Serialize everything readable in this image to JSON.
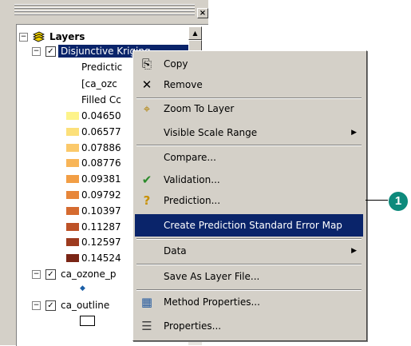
{
  "window": {
    "close_glyph": "×"
  },
  "toc": {
    "root": {
      "label": "Layers",
      "expander": "−",
      "icon": "layers-icon"
    },
    "layer1": {
      "label": "Disjunctive Kriging",
      "expander": "−",
      "checked": "✓",
      "sublabels": [
        "Predictic",
        "[ca_ozc",
        "Filled Cc"
      ],
      "classes": [
        {
          "value": "0.04650",
          "color": "#fdf38a"
        },
        {
          "value": "0.06577",
          "color": "#fce07a"
        },
        {
          "value": "0.07886",
          "color": "#fbc96a"
        },
        {
          "value": "0.08776",
          "color": "#f8b558"
        },
        {
          "value": "0.09381",
          "color": "#f29e45"
        },
        {
          "value": "0.09792",
          "color": "#e7863a"
        },
        {
          "value": "0.10397",
          "color": "#d56b30"
        },
        {
          "value": "0.11287",
          "color": "#bd5227"
        },
        {
          "value": "0.12597",
          "color": "#9d3b1f"
        },
        {
          "value": "0.14524",
          "color": "#7a2515"
        }
      ]
    },
    "layer2": {
      "label": "ca_ozone_p",
      "expander": "−",
      "checked": "✓",
      "symbol": "◆"
    },
    "layer3": {
      "label": "ca_outline",
      "expander": "−",
      "checked": "✓"
    }
  },
  "context_menu": {
    "items": [
      {
        "label": "Copy",
        "icon": "copy-icon",
        "glyph": "⎘"
      },
      {
        "label": "Remove",
        "icon": "remove-icon",
        "glyph": "✕"
      },
      {
        "label": "Zoom To Layer",
        "icon": "zoom-to-layer-icon",
        "glyph": "⌖"
      },
      {
        "label": "Visible Scale Range",
        "submenu": "▶"
      },
      {
        "label": "Compare..."
      },
      {
        "label": "Validation...",
        "icon": "validation-icon",
        "glyph": "✔"
      },
      {
        "label": "Prediction...",
        "icon": "prediction-icon",
        "glyph": "?"
      },
      {
        "label": "Create Prediction Standard Error Map",
        "highlighted": true
      },
      {
        "label": "Data",
        "submenu": "▶"
      },
      {
        "label": "Save As Layer File..."
      },
      {
        "label": "Method Properties...",
        "icon": "method-properties-icon",
        "glyph": "▦"
      },
      {
        "label": "Properties...",
        "icon": "properties-icon",
        "glyph": "☰"
      }
    ]
  },
  "callout": {
    "number": "1",
    "color": "#0d8a7c"
  }
}
